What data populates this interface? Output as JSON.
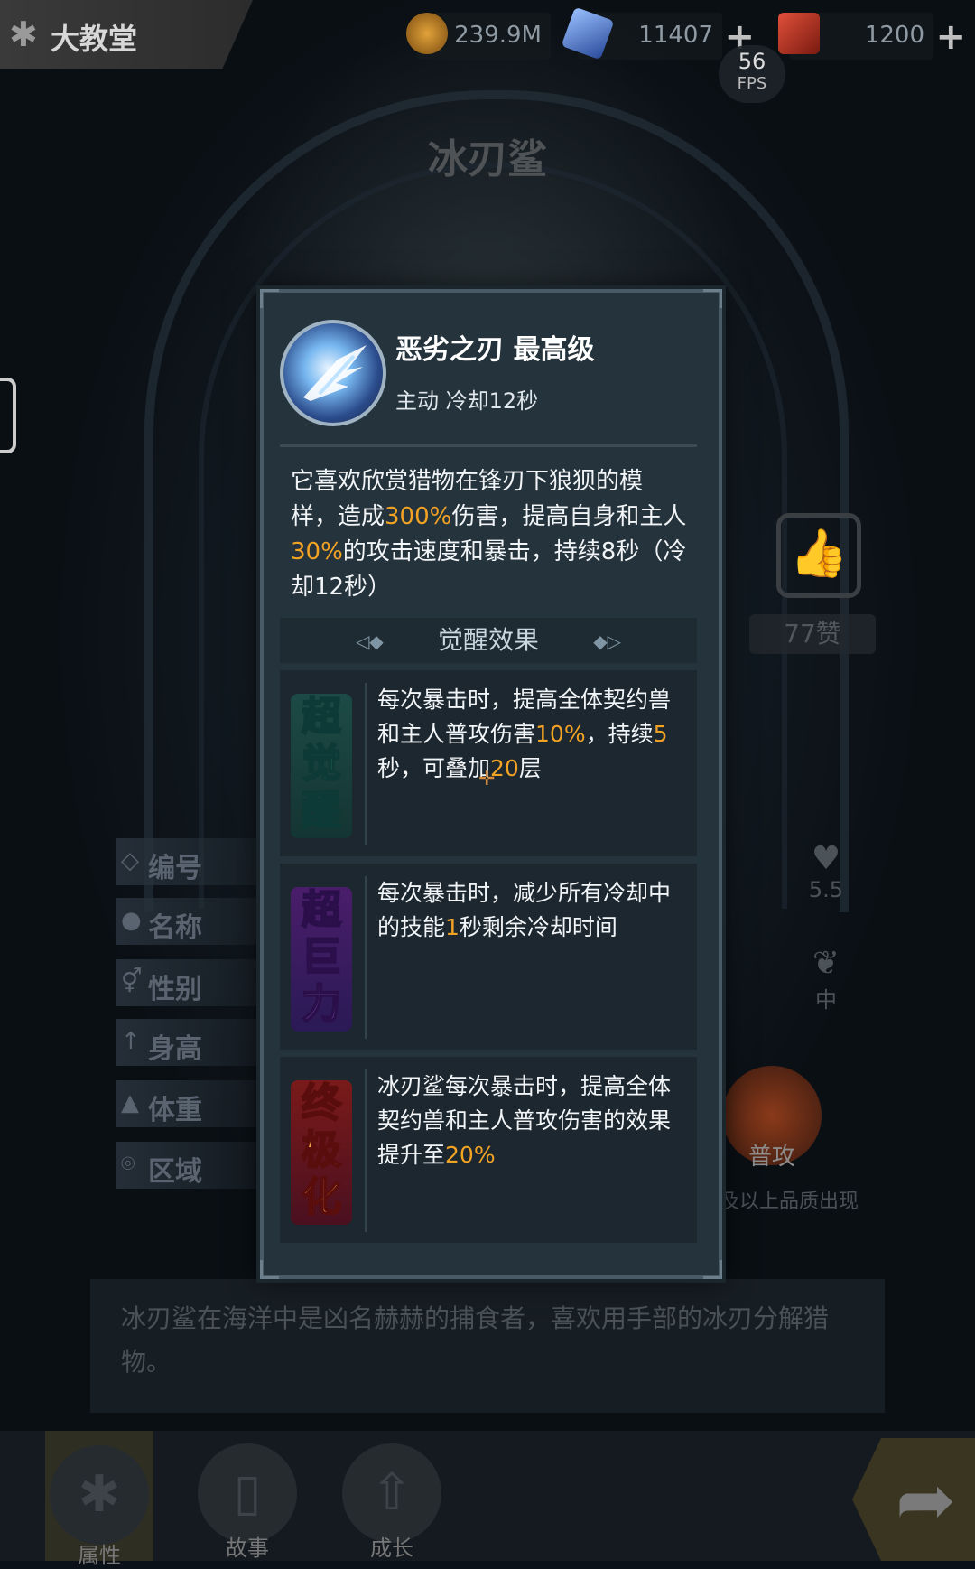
{
  "header": {
    "title": "大教堂",
    "resources": [
      {
        "name": "gold",
        "value": "239.9M",
        "icon": "coin-icon",
        "color": "#c88a2a"
      },
      {
        "name": "crystal",
        "value": "11407",
        "icon": "crystal-icon",
        "color": "#4a7ac8"
      },
      {
        "name": "ticket",
        "value": "1200",
        "icon": "ticket-icon",
        "color": "#b83a2a"
      }
    ],
    "fps_value": "56",
    "fps_label": "FPS"
  },
  "character": {
    "name": "冰刃鲨",
    "like_count": "77赞",
    "stats_labels": [
      "编号",
      "名称",
      "性别",
      "身高",
      "体重",
      "区域"
    ],
    "side_values": [
      "5.5",
      "中"
    ],
    "attack_label": "普攻",
    "quality_note": "白及以上品质出现",
    "description": "冰刃鲨在海洋中是凶名赫赫的捕食者，喜欢用手部的冰刃分解猎物。"
  },
  "nav": {
    "tabs": [
      {
        "label": "属性",
        "icon": "paw-icon"
      },
      {
        "label": "故事",
        "icon": "book-icon"
      },
      {
        "label": "成长",
        "icon": "up-arrow-icon"
      }
    ]
  },
  "skill_popup": {
    "name": "恶劣之刃 最高级",
    "subtitle": "主动 冷却12秒",
    "desc_parts": [
      "它喜欢欣赏猎物在锋刃下狼狈的模样，造成",
      "300%",
      "伤害，提高自身和主人",
      "30%",
      "的攻击速度和暴击，持续8秒（冷却12秒）"
    ],
    "awaken_title": "觉醒效果",
    "awakenings": [
      {
        "badge": "超觉醒",
        "parts": [
          "每次暴击时，提高全体契约兽和主人普攻伤害",
          "10%",
          "，持续",
          "5",
          "秒，可叠加",
          "20",
          "层"
        ]
      },
      {
        "badge": "超巨力",
        "parts": [
          "每次暴击时，减少所有冷却中的技能",
          "1",
          "秒剩余冷却时间"
        ]
      },
      {
        "badge": "终极化",
        "parts": [
          "冰刃鲨每次暴击时，提高全体契约兽和主人普攻伤害的效果提升至",
          "20%",
          ""
        ]
      }
    ]
  }
}
